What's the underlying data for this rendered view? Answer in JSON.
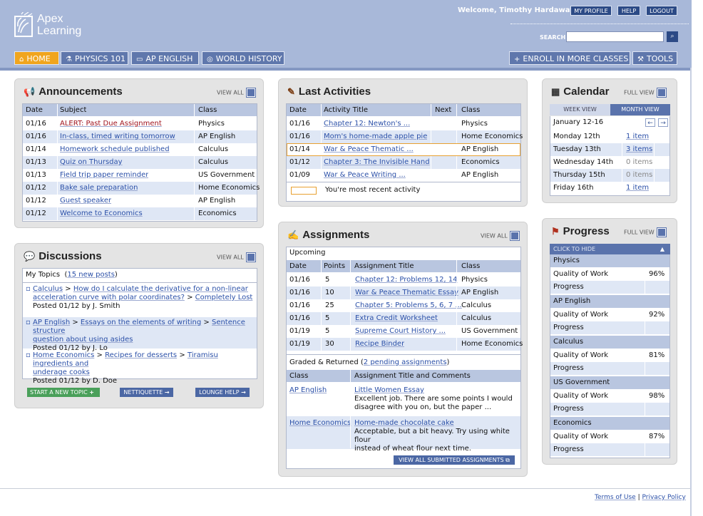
{
  "header": {
    "logo_line1": "Apex",
    "logo_line2": "Learning",
    "welcome": "Welcome, Timothy Hardaway",
    "my_profile": "MY PROFILE",
    "help": "HELP",
    "logout": "LOGOUT",
    "search_label": "SEARCH",
    "search_value": "",
    "search_go": "⌕"
  },
  "nav": {
    "tabs": [
      {
        "label": "HOME",
        "icon": "⌂"
      },
      {
        "label": "PHYSICS 101",
        "icon": "⚗"
      },
      {
        "label": "AP ENGLISH",
        "icon": "▭"
      },
      {
        "label": "WORLD HISTORY",
        "icon": "◎"
      }
    ],
    "enroll": "ENROLL IN MORE CLASSES",
    "enroll_icon": "+",
    "tools": "TOOLS",
    "tools_icon": "⚒"
  },
  "announcements": {
    "title": "Announcements",
    "icon": "megaphone-icon",
    "view_all": "VIEW ALL",
    "headers": [
      "Date",
      "Subject",
      "Class"
    ],
    "rows": [
      {
        "date": "01/16",
        "subject": "ALERT: Past Due Assignment",
        "cls": "Physics",
        "alert": true
      },
      {
        "date": "01/16",
        "subject": "In-class, timed writing tomorrow",
        "cls": "AP English"
      },
      {
        "date": "01/14",
        "subject": "Homework schedule published",
        "cls": "Calculus"
      },
      {
        "date": "01/13",
        "subject": "Quiz on Thursday",
        "cls": "Calculus"
      },
      {
        "date": "01/13",
        "subject": "Field trip paper reminder",
        "cls": "US Government"
      },
      {
        "date": "01/12",
        "subject": "Bake sale preparation",
        "cls": "Home Economics"
      },
      {
        "date": "01/12",
        "subject": "Guest speaker",
        "cls": "AP English"
      },
      {
        "date": "01/12",
        "subject": "Welcome to Economics",
        "cls": "Economics"
      }
    ]
  },
  "discussions": {
    "title": "Discussions",
    "view_all": "VIEW ALL",
    "my_topics": "My Topics",
    "new_posts": "15 new posts",
    "items": [
      {
        "cls": "Calculus",
        "topic_a": "How do I calculate the derivative for a non-linear",
        "topic_b": "acceleration curve with polar coordinates?",
        "reply": "Completely Lost",
        "posted": "Posted 01/12 by J. Smith"
      },
      {
        "cls": "AP English",
        "topic_a": "Essays on the elements of writing",
        "reply_a": "Sentence structure",
        "reply_b": "question about using asides",
        "posted": "Posted 01/12 by J. Lo"
      },
      {
        "cls": "Home Economics",
        "topic_a": "Recipes for desserts",
        "reply_a": "Tiramisu ingredients and",
        "reply_b": "underage cooks",
        "posted": "Posted 01/12 by D. Doe"
      }
    ],
    "new_topic": "START A NEW TOPIC",
    "netiquette": "NETTIQUETTE",
    "lounge": "LOUNGE HELP"
  },
  "activities": {
    "title": "Last Activities",
    "headers": [
      "Date",
      "Activity Title",
      "Next",
      "Class"
    ],
    "rows": [
      {
        "date": "01/16",
        "title": "Chapter 12: Newton's ...",
        "cls": "Physics"
      },
      {
        "date": "01/16",
        "title": "Mom's home-made apple pie",
        "cls": "Home Economics"
      },
      {
        "date": "01/14",
        "title": "War & Peace Thematic ...",
        "cls": "AP English"
      },
      {
        "date": "01/12",
        "title": "Chapter 3: The Invisible Hand",
        "cls": "Economics"
      },
      {
        "date": "01/09",
        "title": "War & Peace Writing ...",
        "cls": "AP English"
      }
    ],
    "legend": "You're most recent activity"
  },
  "assignments": {
    "title": "Assignments",
    "view_all": "VIEW ALL",
    "upcoming": "Upcoming",
    "headers": [
      "Date",
      "Points",
      "Assignment Title",
      "Class"
    ],
    "rows": [
      {
        "date": "01/16",
        "points": "5",
        "title": "Chapter 12: Problems 12, 14",
        "cls": "Physics"
      },
      {
        "date": "01/16",
        "points": "10",
        "title": "War & Peace Thematic Essay",
        "cls": "AP English"
      },
      {
        "date": "01/16",
        "points": "25",
        "title": "Chapter 5: Problems 5, 6, 7 ...",
        "cls": "Calculus"
      },
      {
        "date": "01/16",
        "points": "5",
        "title": "Extra Credit Worksheet",
        "cls": "Calculus"
      },
      {
        "date": "01/19",
        "points": "5",
        "title": "Supreme Court History ...",
        "cls": "US Government"
      },
      {
        "date": "01/19",
        "points": "30",
        "title": "Recipe Binder",
        "cls": "Home Economics"
      }
    ],
    "graded_label": "Graded & Returned",
    "pending": "2 pending assignments",
    "graded_headers": [
      "Class",
      "Assignment Title and Comments"
    ],
    "graded": [
      {
        "cls": "AP English",
        "title": "Little Women Essay",
        "c1": "Excellent job. There are some points I would",
        "c2": "disagree with you on, but the paper ..."
      },
      {
        "cls": "Home Economics",
        "title": "Home-made chocolate cake",
        "c1": "Acceptable, but a bit heavy. Try using white flour",
        "c2": "instead of wheat flour next time."
      }
    ],
    "view_submitted": "VIEW ALL SUBMITTED ASSIGNMENTS"
  },
  "calendar": {
    "title": "Calendar",
    "full_view": "FULL VIEW",
    "week_view": "WEEK VIEW",
    "month_view": "MONTH VIEW",
    "range": "January 12-16",
    "days": [
      {
        "day": "Monday 12th",
        "items": "1 item",
        "has": true
      },
      {
        "day": "Tuesday 13th",
        "items": "3 items",
        "has": true
      },
      {
        "day": "Wednesday 14th",
        "items": "0 items",
        "has": false
      },
      {
        "day": "Thursday 15th",
        "items": "0 items",
        "has": false
      },
      {
        "day": "Friday 16th",
        "items": "1 item",
        "has": true
      }
    ]
  },
  "progress": {
    "title": "Progress",
    "full_view": "FULL VIEW",
    "click_hide": "CLICK TO HIDE",
    "quality_label": "Quality of Work",
    "progress_label": "Progress",
    "classes": [
      {
        "name": "Physics",
        "quality": "96%",
        "color": "#5aac6a"
      },
      {
        "name": "AP English",
        "quality": "92%",
        "color": "#5aac6a"
      },
      {
        "name": "Calculus",
        "quality": "81%",
        "color": "#f0a000"
      },
      {
        "name": "US Government",
        "quality": "98%",
        "color": "#5aac6a"
      },
      {
        "name": "Economics",
        "quality": "87%",
        "color": "#e01010"
      }
    ]
  },
  "footer": {
    "terms": "Terms of Use",
    "divider": "|",
    "privacy": "Privacy Policy"
  }
}
